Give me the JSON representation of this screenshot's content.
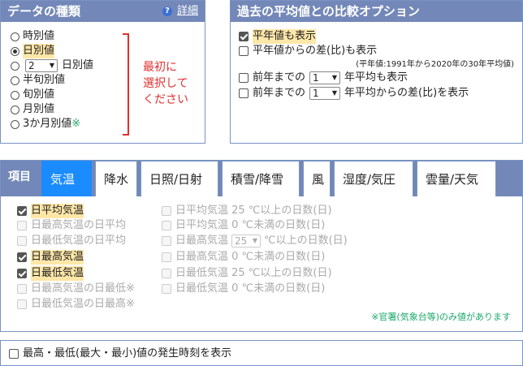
{
  "period": {
    "title": "データの種類",
    "help_link": "詳細",
    "options": [
      {
        "label": "時別値",
        "selected": false
      },
      {
        "label": "日別値",
        "selected": true
      },
      {
        "label": "日別値",
        "selected": false,
        "select_value": "2"
      },
      {
        "label": "半旬別値",
        "selected": false
      },
      {
        "label": "旬別値",
        "selected": false
      },
      {
        "label": "月別値",
        "selected": false
      },
      {
        "label": "3か月別値",
        "selected": false,
        "mark": "※"
      }
    ],
    "note": [
      "最初に",
      "選択して",
      "ください"
    ]
  },
  "compare": {
    "title": "過去の平均値との比較オプション",
    "normal": "平年値も表示",
    "diff": "平年値からの差(比)も表示",
    "diff_note": "(平年値:1991年から2020年の30年平均値)",
    "prev_prefix": "前年までの",
    "prev_value": "1",
    "prev_avg_suffix": "年平均も表示",
    "prev_diff_suffix": "年平均からの差(比)を表示"
  },
  "items": {
    "label": "項目",
    "tabs": [
      "気温",
      "降水",
      "日照/日射",
      "積雪/降雪",
      "風",
      "湿度/気圧",
      "雲量/天気"
    ],
    "active_tab": 0,
    "col1": [
      {
        "text": "日平均気温",
        "checked": true,
        "enabled": true
      },
      {
        "text": "日最高気温の日平均",
        "checked": false,
        "enabled": false
      },
      {
        "text": "日最低気温の日平均",
        "checked": false,
        "enabled": false
      },
      {
        "text": "日最高気温",
        "checked": true,
        "enabled": true
      },
      {
        "text": "日最低気温",
        "checked": true,
        "enabled": true
      },
      {
        "text": "日最高気温の日最低※",
        "checked": false,
        "enabled": false
      },
      {
        "text": "日最低気温の日最高※",
        "checked": false,
        "enabled": false
      }
    ],
    "col2": [
      {
        "text": "日平均気温 25 ℃以上の日数(日)"
      },
      {
        "text": "日平均気温 0 ℃未満の日数(日)"
      },
      {
        "pre": "日最高気温",
        "select": "25",
        "post": "℃以上の日数(日)"
      },
      {
        "text": "日最高気温 0 ℃未満の日数(日)"
      },
      {
        "text": "日最低気温 25 ℃以上の日数(日)"
      },
      {
        "text": "日最低気温 0 ℃未満の日数(日)"
      }
    ],
    "note": "※官署(気象台等)のみ値があります"
  },
  "extreme": {
    "label": "最高・最低(最大・最小)値の発生時刻を表示"
  },
  "colors": {
    "header": "#7388b8",
    "active_tab": "#1a8cff",
    "highlight": "#ffe7a8",
    "red": "#e03030",
    "green": "#1ca86b"
  }
}
